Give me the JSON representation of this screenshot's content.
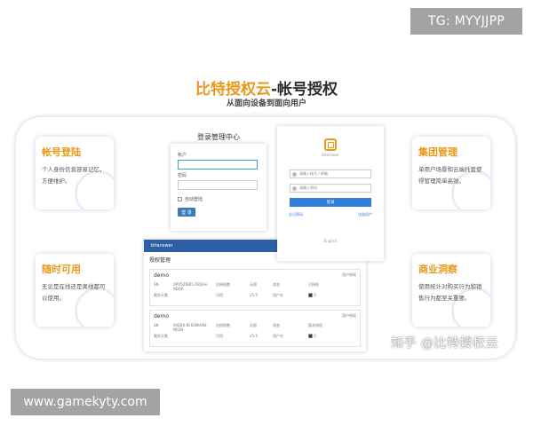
{
  "badges": {
    "telegram": "TG: MYYJJPP",
    "site": "www.gamekyty.com"
  },
  "hero": {
    "title_highlight": "比特授权云",
    "title_rest": "-帐号授权",
    "subtitle": "从面向设备到面向用户"
  },
  "features": [
    {
      "title": "帐号登陆",
      "desc": "个人身份信息容易记忆，方便维护。",
      "icon": "account-icon"
    },
    {
      "title": "随时可用",
      "desc": "无论是在线还是离线都可以使用。",
      "icon": "cloud-icon"
    },
    {
      "title": "集团管理",
      "desc": "单用户场景和云端托管使得管理简单高效。",
      "icon": "group-icon"
    },
    {
      "title": "商业洞察",
      "desc": "使用统计对购买行为和销售行为都至关重要。",
      "icon": "insight-icon"
    }
  ],
  "login": {
    "heading": "登录管理中心",
    "account_label": "帐户",
    "password_label": "密码",
    "remember": "自动登陆",
    "submit": "登 录"
  },
  "admin": {
    "logo": "bitanswer",
    "title": "授权管理",
    "rows": [
      {
        "name": "demo",
        "action": "用户授权",
        "cells": [
          "SN",
          "XPO5ZRBFL7BQEH-NDAR",
          "总授权数",
          "无限",
          "状态",
          "已授权",
          "剩余天数",
          "",
          "可用",
          "V1.0",
          "用户名",
          "⬛ 0"
        ]
      },
      {
        "name": "demo",
        "action": "用户授权",
        "cells": [
          "SN",
          "RAEB0-RF6SMHAN-NFDB",
          "总授权数",
          "无限",
          "状态",
          "版本授权",
          "剩余天数",
          "",
          "可用",
          "V1.0",
          "用户名",
          "⬛ 0"
        ]
      }
    ]
  },
  "sso": {
    "brand": "Bitanswer",
    "username_placeholder": "请输入帐号 / 邮箱",
    "password_placeholder": "请输入密码",
    "submit": "登录",
    "link_left": "忘记密码",
    "link_right": "注册用户",
    "language": "English"
  },
  "watermark": "知乎 @比特授权云",
  "colors": {
    "accent": "#e69a1c",
    "primary_blue": "#2f7ed8",
    "admin_bar": "#2e5fa6",
    "badge_bg": "#a3a3a3"
  }
}
